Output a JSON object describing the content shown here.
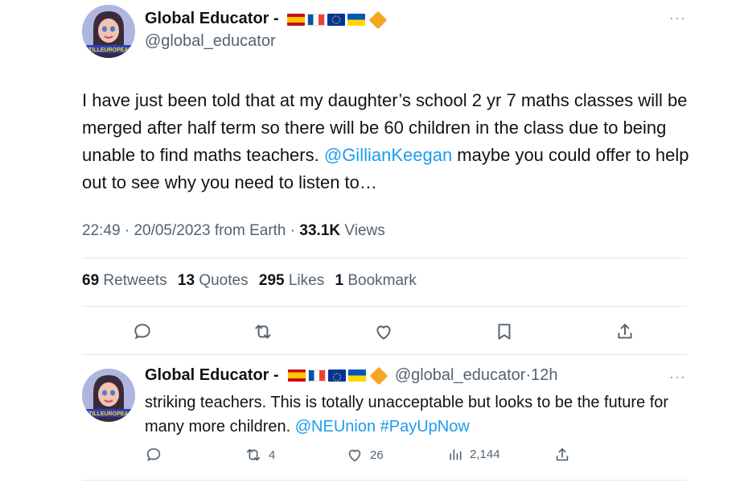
{
  "main_tweet": {
    "author_name": "Global Educator -",
    "handle": "@global_educator",
    "more": "···",
    "text_before": "I have just been told that at my daughter’s school 2 yr 7 maths classes will be merged after half term so there will be 60 children in the class due to being unable to find maths teachers. ",
    "mention": "@GillianKeegan",
    "text_after": " maybe you could offer to help out to see why you need to listen to…",
    "time": "22:49",
    "date": "20/05/2023",
    "source": "from Earth",
    "views_count": "33.1K",
    "views_label": "Views",
    "separator": "·",
    "retweets_count": "69",
    "retweets_label": "Retweets",
    "quotes_count": "13",
    "quotes_label": "Quotes",
    "likes_count": "295",
    "likes_label": "Likes",
    "bookmarks_count": "1",
    "bookmarks_label": "Bookmark"
  },
  "reply": {
    "author_name": "Global Educator -",
    "handle": "@global_educator",
    "separator": "·",
    "age": "12h",
    "more": "···",
    "text_before": "striking teachers.  This is totally unacceptable but looks to be the future for many more children. ",
    "mention": "@NEUnion",
    "hashtag": "#PayUpNow",
    "retweets": "4",
    "likes": "26",
    "views": "2,144"
  },
  "avatar_badge_text": "STILLEUROPEAN",
  "icons": [
    "reply-icon",
    "retweet-icon",
    "like-icon",
    "bookmark-icon",
    "share-icon",
    "views-icon"
  ],
  "colors": {
    "link": "#1d9bf0",
    "secondary": "#536471",
    "text": "#0f1419",
    "divider": "#e1e6ea"
  }
}
